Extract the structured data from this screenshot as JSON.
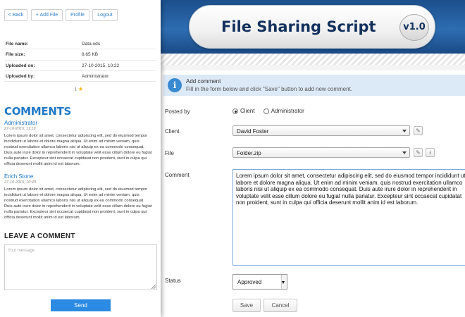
{
  "header": {
    "title": "File Sharing Script",
    "version": "v1.0"
  },
  "info": {
    "title": "Add comment",
    "text": "Fill in the form below and click \"Save\" button to add new comment."
  },
  "form": {
    "posted_by_label": "Posted by",
    "posted_by_options": [
      "Client",
      "Administrator"
    ],
    "posted_by_selected": "Client",
    "client_label": "Client",
    "client_value": "David Foster",
    "file_label": "File",
    "file_value": "Folder.zip",
    "comment_label": "Comment",
    "comment_value": "Lorem ipsum dolor sit amet, consectetur adipiscing elit, sed do eiusmod tempor incididunt ut labore et dolore magna aliqua. Ut enim ad minim veniam, quis nostrud exercitation ullamco laboris nisi ut aliquip ex ea commodo consequat. Duis aute irure dolor in reprehenderit in voluptate velit esse cillum dolore eu fugiat nulla pariatur. Excepteur sint occaecat cupidatat non proident, sunt in culpa qui officia deserunt mollit anim id est laborum.",
    "status_label": "Status",
    "status_value": "Approved",
    "save_label": "Save",
    "cancel_label": "Cancel"
  },
  "panel": {
    "nav": {
      "back": "< Back",
      "add_file": "+ Add File",
      "profile": "Profile",
      "logout": "Logout"
    },
    "file_info": [
      {
        "key": "File name:",
        "value": "Data.ods"
      },
      {
        "key": "File size:",
        "value": "8.65 KB"
      },
      {
        "key": "Uploaded on:",
        "value": "27-10-2015, 10:22"
      },
      {
        "key": "Uploaded by:",
        "value": "Administrator"
      }
    ],
    "icons": [
      "download-icon",
      "star-icon"
    ],
    "comments_title": "COMMENTS",
    "comments": [
      {
        "author": "Administrator",
        "date": "27-10-2015, 11:19",
        "text": "Lorem ipsum dolor sit amet, consectetur adipiscing elit, sed do eiusmod tempor incididunt ut labore et dolore magna aliqua. Ut enim ad minim veniam, quis nostrud exercitation ullamco laboris nisi ut aliquip ex ea commodo consequat. Duis aute irure dolor in reprehenderit in voluptate velit esse cillum dolore eu fugiat nulla pariatur. Excepteur sint occaecat cupidatat non proident, sunt in culpa qui officia deserunt mollit anim id est laborum."
      },
      {
        "author": "Erich Stone",
        "date": "27-10-2015, 10:43",
        "text": "Lorem ipsum dolor sit amet, consectetur adipiscing elit, sed do eiusmod tempor incididunt ut labore et dolore magna aliqua. Ut enim ad minim veniam, quis nostrud exercitation ullamco laboris nisi ut aliquip ex ea commodo consequat. Duis aute irure dolor in reprehenderit in voluptate velit esse cillum dolore eu fugiat nulla pariatur. Excepteur sint occaecat cupidatat non proident, sunt in culpa qui officia deserunt mollit anim id est laborum."
      }
    ],
    "leave_title": "LEAVE A COMMENT",
    "message_placeholder": "Your message",
    "send_label": "Send"
  },
  "colors": {
    "accent": "#1f78c8",
    "header_blue": "#2e6db2",
    "send_button": "#2b8ae2",
    "info_bar": "#dce9f6"
  }
}
